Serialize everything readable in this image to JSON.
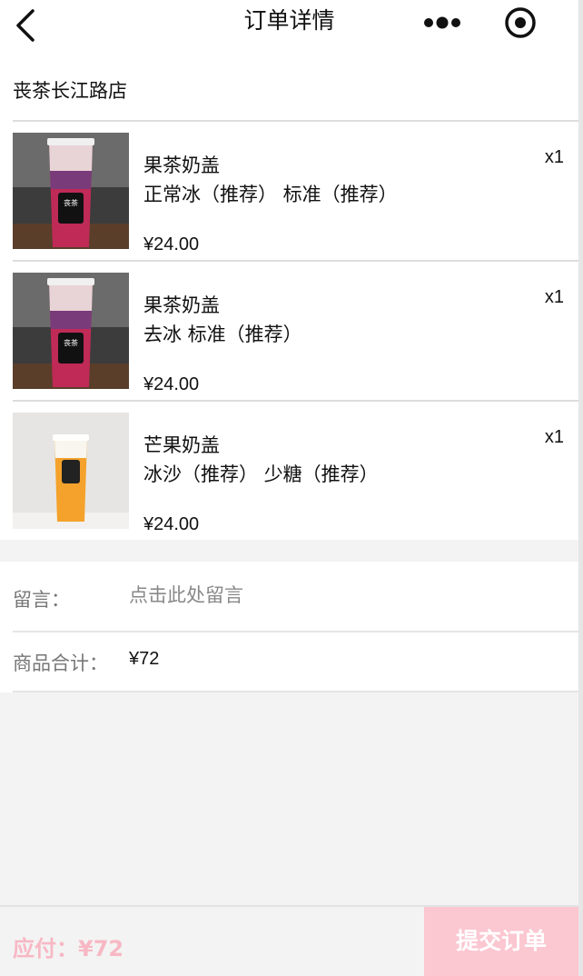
{
  "nav": {
    "title": "订单详情"
  },
  "store": {
    "name": "丧茶长江路店"
  },
  "items": [
    {
      "name": "果茶奶盖",
      "spec": "正常冰（推荐） 标准（推荐）",
      "price": "¥24.00",
      "qty": "x1",
      "drink_color": "#b3264f",
      "icon": "drink-photo"
    },
    {
      "name": "果茶奶盖",
      "spec": "去冰 标准（推荐）",
      "price": "¥24.00",
      "qty": "x1",
      "drink_color": "#b3264f",
      "icon": "drink-photo"
    },
    {
      "name": "芒果奶盖",
      "spec": "冰沙（推荐） 少糖（推荐）",
      "price": "¥24.00",
      "qty": "x1",
      "drink_color": "#f5a52a",
      "icon": "drink-photo"
    }
  ],
  "message": {
    "label": "留言：",
    "placeholder": "点击此处留言"
  },
  "total": {
    "label": "商品合计：",
    "value": "¥72"
  },
  "footer": {
    "pay_text": "应付：¥72",
    "submit_label": "提交订单"
  },
  "colors": {
    "accent_pink": "#fbc7d1",
    "pay_pink": "#f7b8c4"
  }
}
